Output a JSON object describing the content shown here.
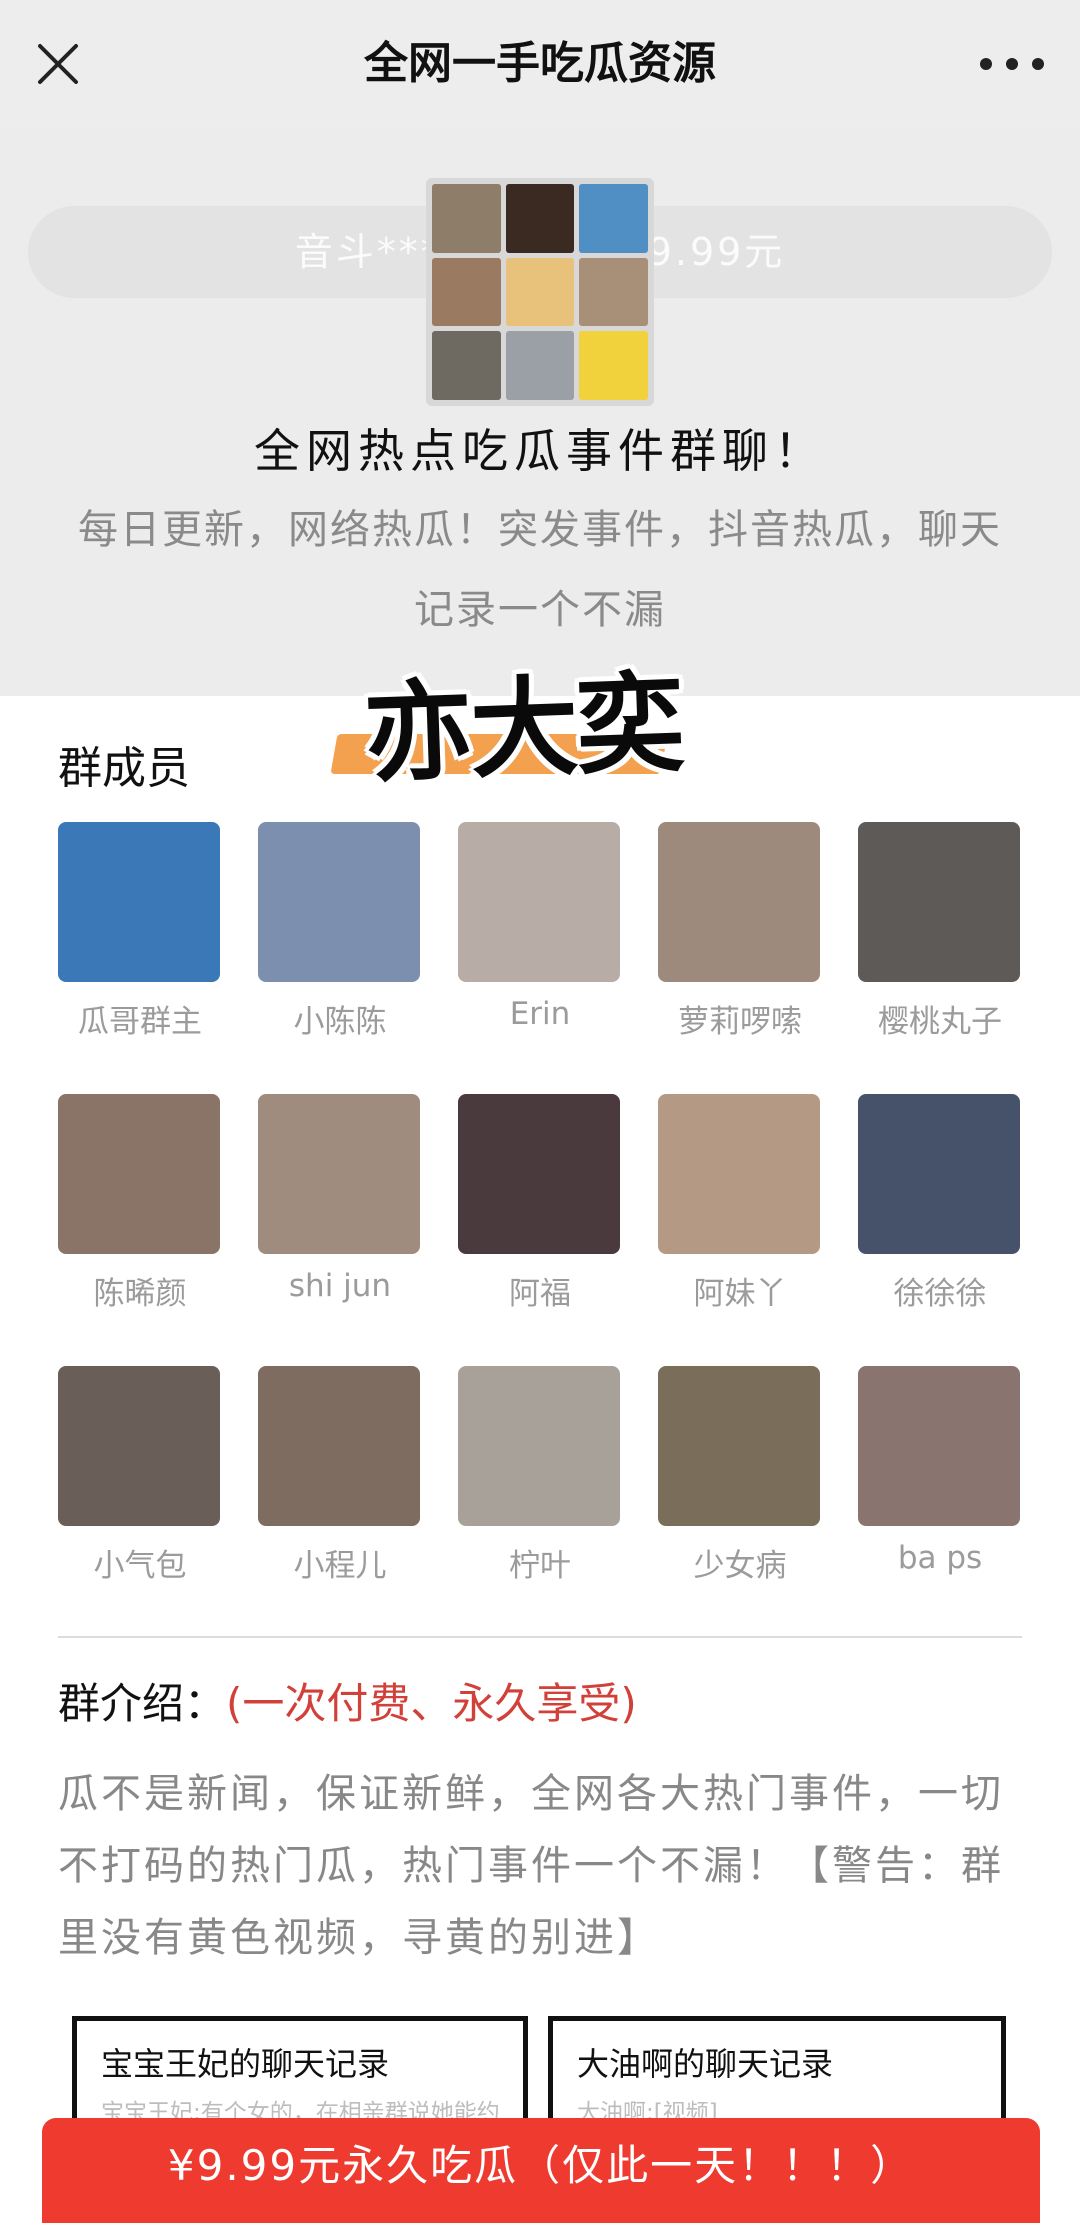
{
  "nav": {
    "title": "全网一手吃瓜资源"
  },
  "hero": {
    "pill_text": "音斗***加入了该群9.99元",
    "title": "全网热点吃瓜事件群聊！",
    "description": "每日更新，网络热瓜！突发事件，抖音热瓜，聊天记录一个不漏",
    "sticker": "亦大奕"
  },
  "members": {
    "label": "群成员",
    "items": [
      {
        "name": "瓜哥群主"
      },
      {
        "name": "小陈陈"
      },
      {
        "name": "Erin"
      },
      {
        "name": "萝莉啰嗦"
      },
      {
        "name": "樱桃丸子"
      },
      {
        "name": "陈晞颜"
      },
      {
        "name": "shi jun"
      },
      {
        "name": "阿福"
      },
      {
        "name": "阿妹丫"
      },
      {
        "name": "徐徐徐"
      },
      {
        "name": "小气包"
      },
      {
        "name": "小程儿"
      },
      {
        "name": "柠叶"
      },
      {
        "name": "少女病"
      },
      {
        "name": "ba ps"
      }
    ]
  },
  "intro": {
    "label": "群介绍：",
    "highlight": "(一次付费、永久享受)",
    "body": "瓜不是新闻，保证新鲜，全网各大热门事件，一切不打码的热门瓜，热门事件一个不漏！【警告：群里没有黄色视频，寻黄的别进】"
  },
  "chats": [
    {
      "title": "宝宝王妃的聊天记录",
      "preview": "宝宝王妃:有个女的，在相亲群说她能约"
    },
    {
      "title": "大油啊的聊天记录",
      "preview": "大油啊:[视频]"
    }
  ],
  "cta": {
    "label": "¥9.99元永久吃瓜（仅此一天！！！）"
  },
  "colors": {
    "accent": "#ef3a2f",
    "highlight": "#d2403a",
    "nav_bg": "#ededed"
  }
}
